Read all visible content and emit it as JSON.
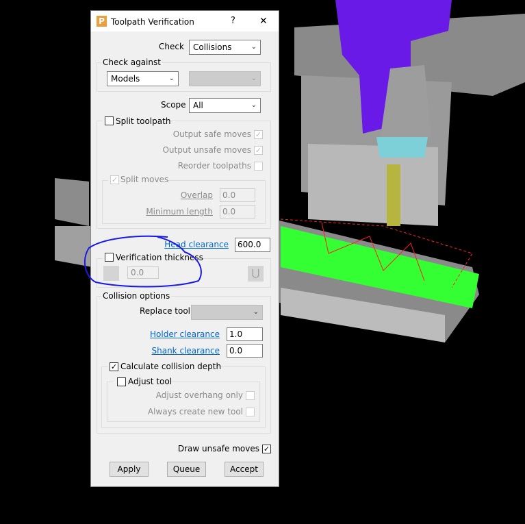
{
  "dialog": {
    "title": "Toolpath Verification",
    "help_label": "?",
    "close_label": "✕",
    "app_icon_letter": "P",
    "check": {
      "label": "Check",
      "value": "Collisions"
    },
    "check_against": {
      "label": "Check against",
      "value": "Models",
      "secondary_value": ""
    },
    "scope": {
      "label": "Scope",
      "value": "All"
    },
    "split_toolpath": {
      "label": "Split toolpath",
      "checked": false,
      "output_safe_moves": {
        "label": "Output safe moves",
        "checked": true
      },
      "output_unsafe_moves": {
        "label": "Output unsafe moves",
        "checked": true
      },
      "reorder_toolpaths": {
        "label": "Reorder toolpaths",
        "checked": false
      },
      "split_moves": {
        "label": "Split moves",
        "checked": true,
        "overlap": {
          "label": "Overlap",
          "value": "0.0"
        },
        "minimum_length": {
          "label": "Minimum length",
          "value": "0.0"
        }
      }
    },
    "head_clearance": {
      "label": "Head clearance",
      "value": "600.0"
    },
    "verification_thickness": {
      "label": "Verification thickness",
      "checked": false,
      "value": "0.0"
    },
    "collision_options": {
      "label": "Collision options",
      "replace_tool": {
        "label": "Replace tool",
        "value": ""
      },
      "holder_clearance": {
        "label": "Holder clearance",
        "value": "1.0"
      },
      "shank_clearance": {
        "label": "Shank clearance",
        "value": "0.0"
      },
      "calculate_collision_depth": {
        "label": "Calculate collision depth",
        "checked": true
      },
      "adjust_tool": {
        "label": "Adjust tool",
        "checked": false,
        "adjust_overhang_only": {
          "label": "Adjust overhang only",
          "checked": false
        },
        "always_create_new_tool": {
          "label": "Always create new tool",
          "checked": false
        }
      }
    },
    "draw_unsafe_moves": {
      "label": "Draw unsafe moves",
      "checked": true
    },
    "buttons": {
      "apply": "Apply",
      "queue": "Queue",
      "accept": "Accept"
    },
    "check_glyph": "✓",
    "chevron": "⌄"
  },
  "colors": {
    "annotation": "#1a1ae6",
    "link": "#0066cc",
    "machine_head": "#6a1ae6",
    "toolpath": "#33ff33"
  }
}
